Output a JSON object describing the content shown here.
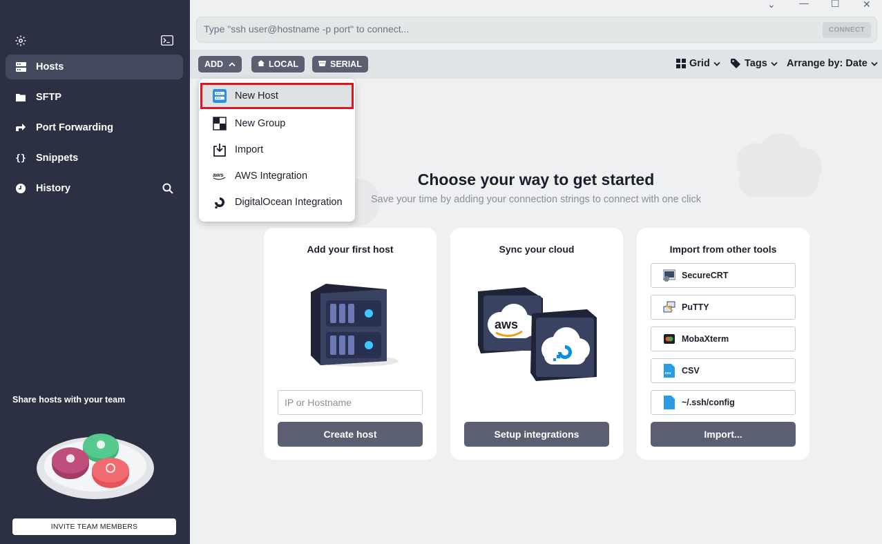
{
  "sidebar": {
    "items": [
      {
        "label": "Hosts",
        "icon": "hosts-icon",
        "active": true
      },
      {
        "label": "SFTP",
        "icon": "folder-icon"
      },
      {
        "label": "Port Forwarding",
        "icon": "port-forward-icon"
      },
      {
        "label": "Snippets",
        "icon": "braces-icon"
      },
      {
        "label": "History",
        "icon": "clock-icon"
      }
    ],
    "share_title": "Share hosts with your team",
    "invite_label": "INVITE TEAM MEMBERS"
  },
  "window_controls": {
    "minimize": "—",
    "maximize": "☐",
    "close": "✕",
    "chevron": "⌄"
  },
  "command_bar": {
    "placeholder": "Type \"ssh user@hostname -p port\" to connect...",
    "connect_label": "CONNECT"
  },
  "toolbar": {
    "add_label": "ADD",
    "local_label": "LOCAL",
    "serial_label": "SERIAL",
    "grid_label": "Grid",
    "tags_label": "Tags",
    "arrange_label": "Arrange by: Date"
  },
  "add_menu": {
    "items": [
      {
        "label": "New Host",
        "icon": "new-host-icon"
      },
      {
        "label": "New Group",
        "icon": "new-group-icon"
      },
      {
        "label": "Import",
        "icon": "import-icon"
      },
      {
        "label": "AWS Integration",
        "icon": "aws-icon"
      },
      {
        "label": "DigitalOcean Integration",
        "icon": "digitalocean-icon"
      }
    ]
  },
  "hero": {
    "title": "Choose your way to get started",
    "subtitle": "Save your time by adding your connection strings to connect with one click"
  },
  "cards": {
    "host": {
      "title": "Add your first host",
      "input_placeholder": "IP or Hostname",
      "button": "Create host"
    },
    "cloud": {
      "title": "Sync your cloud",
      "button": "Setup integrations",
      "aws_text": "aws"
    },
    "import": {
      "title": "Import from other tools",
      "tools": [
        "SecureCRT",
        "PuTTY",
        "MobaXterm",
        "CSV",
        "~/.ssh/config"
      ],
      "csv_badge": "csv",
      "button": "Import..."
    }
  },
  "colors": {
    "sidebar_bg": "#2b3042",
    "button_bg": "#5a6072",
    "highlight_border": "#e0141e",
    "accent_blue": "#3a8de0"
  }
}
